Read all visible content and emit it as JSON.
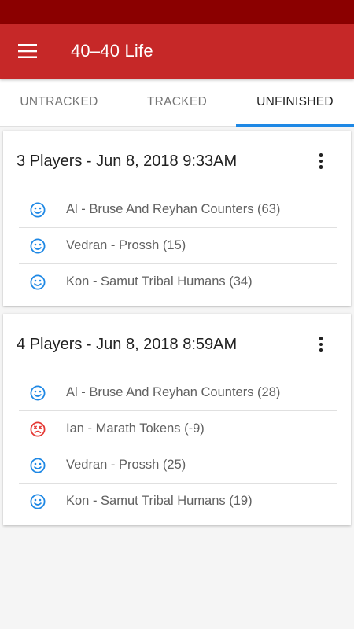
{
  "app": {
    "title": "40–40 Life"
  },
  "colors": {
    "status_bar": "#8b0000",
    "app_bar": "#c62828",
    "accent": "#1e88e5",
    "alive": "#1e88e5",
    "dead": "#e53935"
  },
  "tabs": [
    {
      "label": "UNTRACKED"
    },
    {
      "label": "TRACKED"
    },
    {
      "label": "UNFINISHED",
      "active": true
    }
  ],
  "games": [
    {
      "title": "3 Players - Jun 8, 2018 9:33AM",
      "players": [
        {
          "text": "Al - Bruse And Reyhan Counters (63)",
          "icon": "smiley-icon"
        },
        {
          "text": "Vedran - Prossh (15)",
          "icon": "smiley-icon"
        },
        {
          "text": "Kon - Samut Tribal Humans (34)",
          "icon": "smiley-icon"
        }
      ]
    },
    {
      "title": "4 Players - Jun 8, 2018 8:59AM",
      "players": [
        {
          "text": "Al - Bruse And Reyhan Counters (28)",
          "icon": "smiley-icon"
        },
        {
          "text": "Ian - Marath Tokens (-9)",
          "icon": "dead-face-icon"
        },
        {
          "text": "Vedran - Prossh (25)",
          "icon": "smiley-icon"
        },
        {
          "text": "Kon - Samut Tribal Humans (19)",
          "icon": "smiley-icon"
        }
      ]
    }
  ]
}
